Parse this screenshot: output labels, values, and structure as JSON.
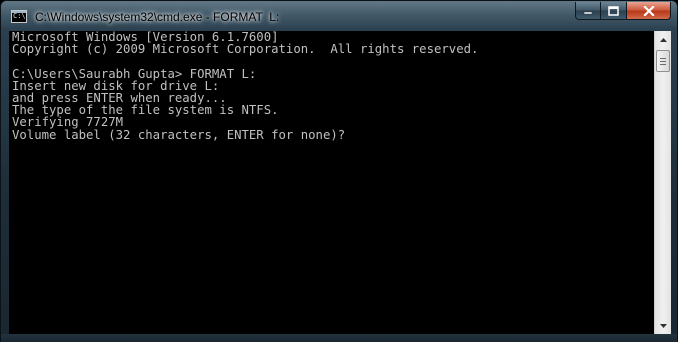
{
  "window": {
    "title": "C:\\Windows\\system32\\cmd.exe - FORMAT  L:",
    "icon": "console-icon"
  },
  "console": {
    "lines": [
      "Microsoft Windows [Version 6.1.7600]",
      "Copyright (c) 2009 Microsoft Corporation.  All rights reserved.",
      "",
      "C:\\Users\\Saurabh Gupta> FORMAT L:",
      "Insert new disk for drive L:",
      "and press ENTER when ready...",
      "The type of the file system is NTFS.",
      "Verifying 7727M",
      "Volume label (32 characters, ENTER for none)?"
    ],
    "text_color": "#c0c0c0",
    "background": "#000000"
  },
  "caption_buttons": [
    "minimize-icon",
    "maximize-icon",
    "close-icon"
  ]
}
